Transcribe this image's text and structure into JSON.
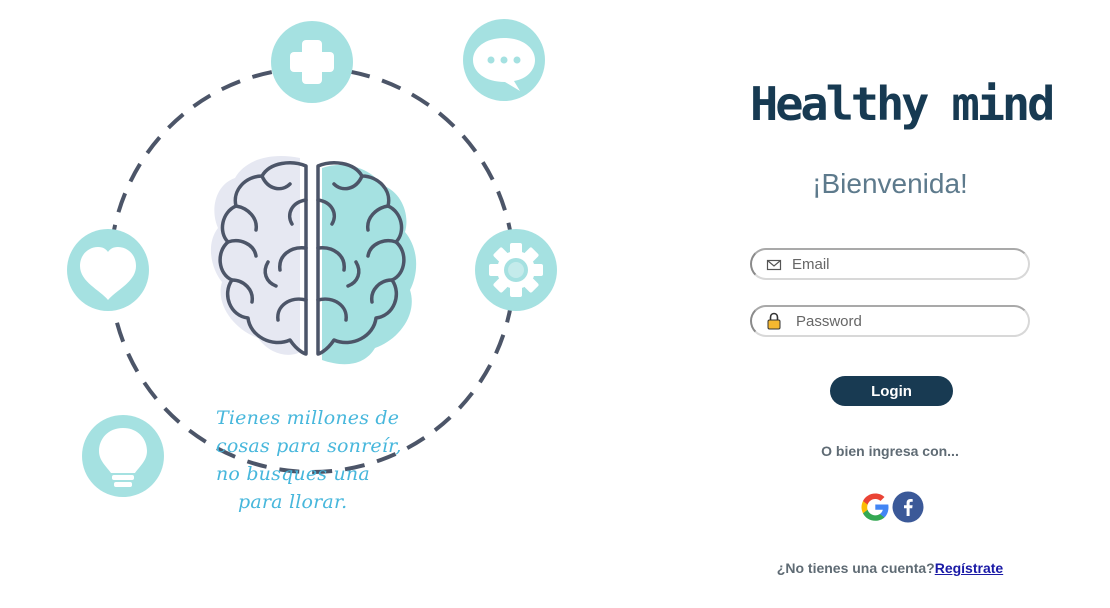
{
  "illustration": {
    "quote_lines": [
      "Tienes millones de",
      "cosas para sonreír,",
      "no busques una",
      "para llorar."
    ],
    "accent_color": "#a5e1e1",
    "line_color": "#4c5568",
    "quote_color": "#47b7dc",
    "icons": [
      "plus-icon",
      "chat-bubble-icon",
      "heart-icon",
      "gear-icon",
      "lightbulb-icon",
      "brain-icon"
    ]
  },
  "login": {
    "brand": "Healthy mind",
    "brand_color": "#173a52",
    "welcome": "¡Bienvenida!",
    "email": {
      "placeholder": "Email",
      "value": ""
    },
    "password": {
      "placeholder": "Password",
      "value": ""
    },
    "login_label": "Login",
    "button_color": "#183a52",
    "alt_text": "O bien ingresa con...",
    "social": [
      "google-icon",
      "facebook-icon"
    ],
    "signup_prompt": "¿No tienes una cuenta?",
    "signup_link": "Regístrate"
  }
}
